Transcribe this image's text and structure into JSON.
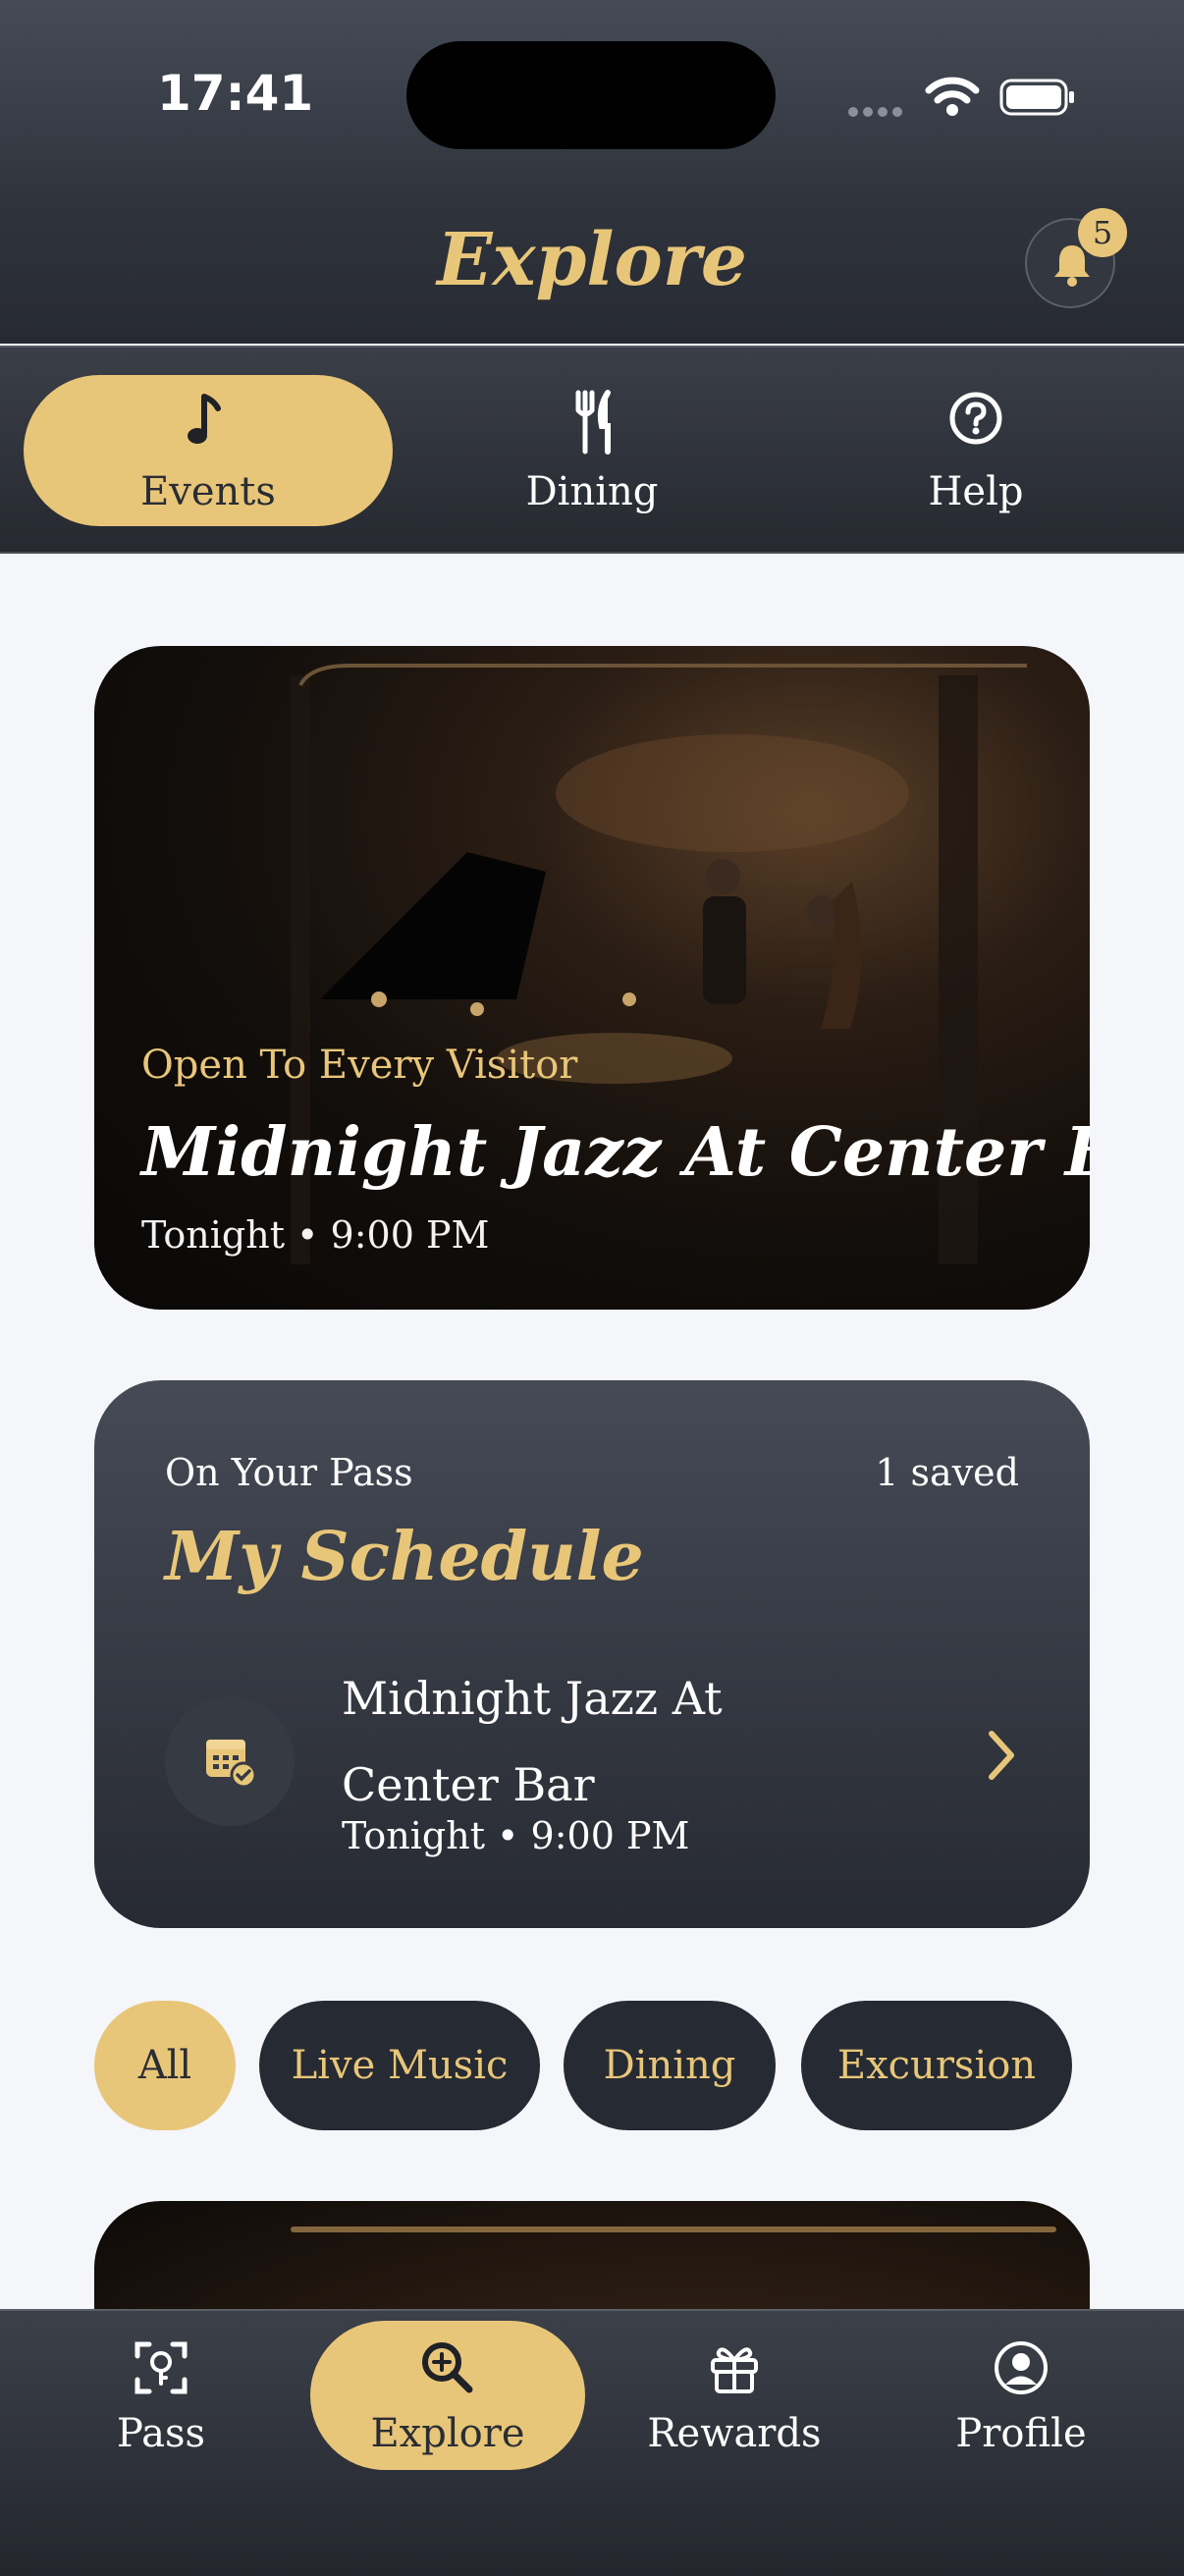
{
  "status_bar": {
    "time": "17:41"
  },
  "header": {
    "title": "Explore",
    "notification_count": "5"
  },
  "tabs": [
    {
      "label": "Events",
      "icon": "music-note-icon",
      "active": true
    },
    {
      "label": "Dining",
      "icon": "fork-knife-icon",
      "active": false
    },
    {
      "label": "Help",
      "icon": "question-circle-icon",
      "active": false
    }
  ],
  "hero": {
    "subtitle": "Open To Every Visitor",
    "title": "Midnight Jazz At Center Bar",
    "time": "Tonight • 9:00 PM"
  },
  "schedule": {
    "overline": "On Your Pass",
    "count": "1 saved",
    "title": "My Schedule",
    "item": {
      "name": "Midnight Jazz At Center Bar",
      "time": "Tonight • 9:00 PM",
      "icon": "calendar-check-icon"
    }
  },
  "filters": [
    {
      "label": "All",
      "active": true
    },
    {
      "label": "Live Music",
      "active": false
    },
    {
      "label": "Dining",
      "active": false
    },
    {
      "label": "Excursion",
      "active": false
    }
  ],
  "bottom_nav": [
    {
      "label": "Pass",
      "icon": "pass-icon",
      "active": false
    },
    {
      "label": "Explore",
      "icon": "search-icon",
      "active": true
    },
    {
      "label": "Rewards",
      "icon": "gift-icon",
      "active": false
    },
    {
      "label": "Profile",
      "icon": "profile-icon",
      "active": false
    }
  ],
  "colors": {
    "accent": "#e8c679",
    "dark": "#262a33",
    "background": "#f4f6fa"
  }
}
